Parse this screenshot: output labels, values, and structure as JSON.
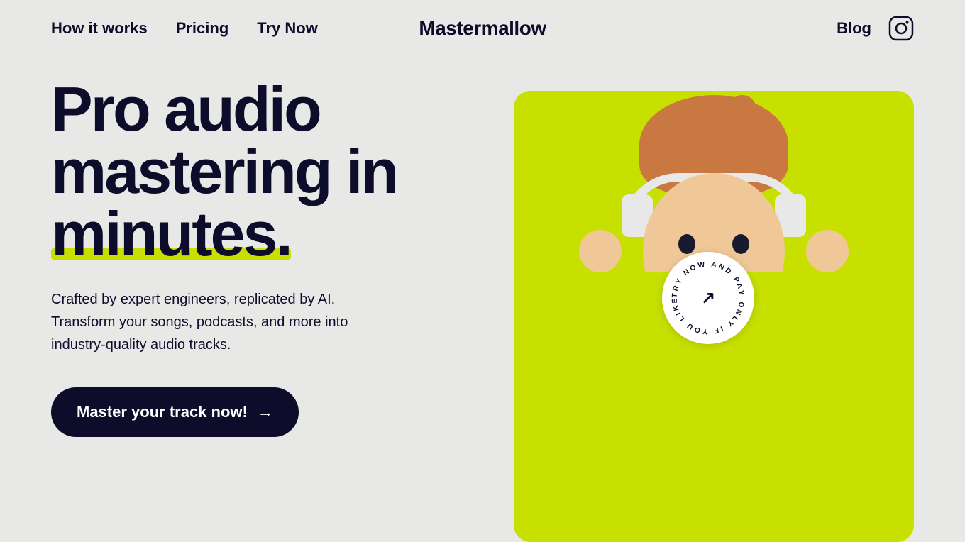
{
  "nav": {
    "links": [
      {
        "id": "how-it-works",
        "label": "How it works"
      },
      {
        "id": "pricing",
        "label": "Pricing"
      },
      {
        "id": "try-now",
        "label": "Try Now"
      }
    ],
    "brand": "Mastermallow",
    "blog_label": "Blog"
  },
  "hero": {
    "title_line1": "Pro audio",
    "title_line2": "mastering in",
    "title_line3": "minutes.",
    "subtitle": "Crafted by expert engineers, replicated by AI. Transform your songs, podcasts, and more into industry-quality audio tracks.",
    "cta_label": "Master your track now!",
    "badge_text": "TRY NOW AND PAY ONLY IF YOU LIKE IT ·"
  },
  "colors": {
    "bg": "#e8e8e6",
    "dark": "#0d0d2b",
    "accent": "#c8e000",
    "white": "#ffffff"
  }
}
